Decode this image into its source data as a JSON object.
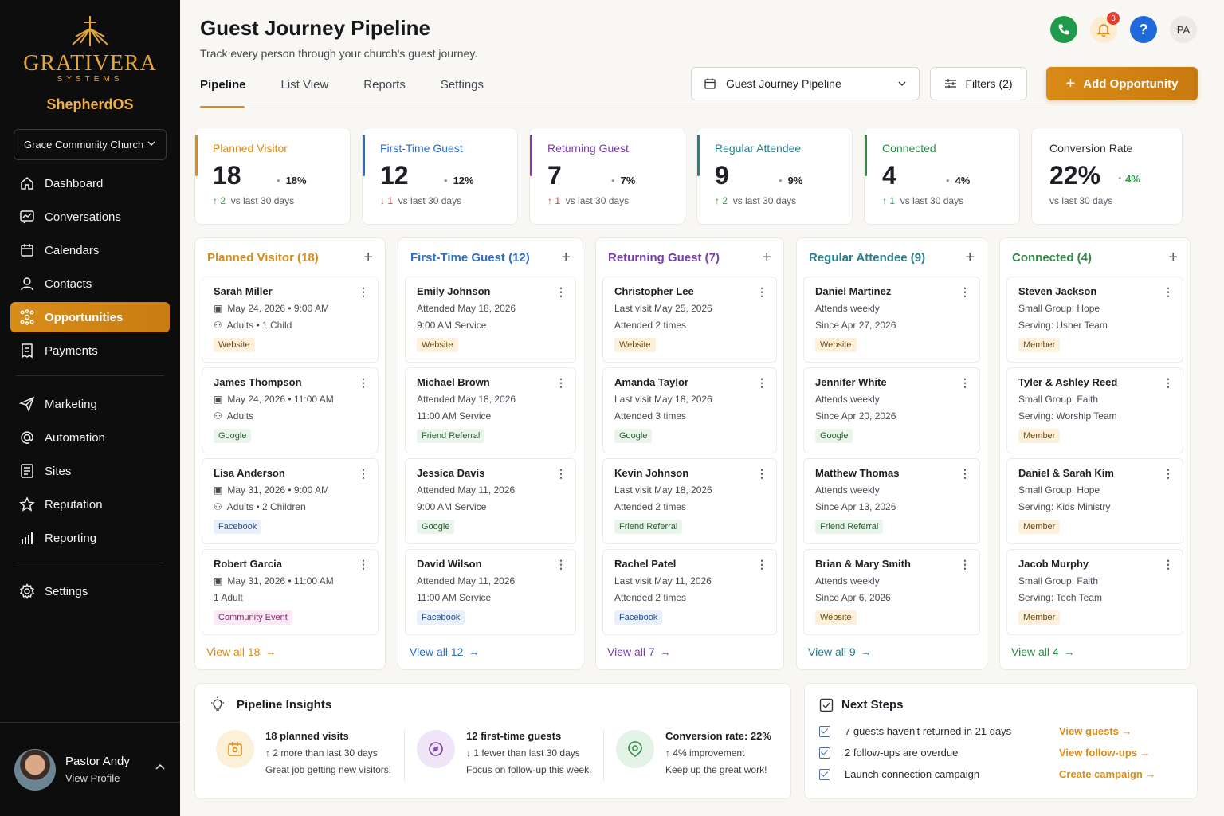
{
  "brand": {
    "name": "GRATIVERA",
    "sub": "SYSTEMS",
    "app": "ShepherdOS"
  },
  "church_selector": "Grace Community Church",
  "nav": [
    {
      "label": "Dashboard",
      "icon": "home-icon"
    },
    {
      "label": "Conversations",
      "icon": "chat-icon"
    },
    {
      "label": "Calendars",
      "icon": "calendar-icon"
    },
    {
      "label": "Contacts",
      "icon": "user-icon"
    },
    {
      "label": "Opportunities",
      "icon": "network-icon",
      "active": true
    },
    {
      "label": "Payments",
      "icon": "receipt-icon"
    },
    {
      "label": "Marketing",
      "icon": "send-icon"
    },
    {
      "label": "Automation",
      "icon": "at-icon"
    },
    {
      "label": "Sites",
      "icon": "sites-icon"
    },
    {
      "label": "Reputation",
      "icon": "star-icon"
    },
    {
      "label": "Reporting",
      "icon": "bars-icon"
    },
    {
      "label": "Settings",
      "icon": "gear-icon"
    }
  ],
  "profile": {
    "name": "Pastor Andy",
    "sub": "View Profile"
  },
  "header": {
    "title": "Guest Journey Pipeline",
    "subtitle": "Track every person through your church's guest journey.",
    "notif_count": "3",
    "initials": "PA"
  },
  "tabs": [
    "Pipeline",
    "List View",
    "Reports",
    "Settings"
  ],
  "pipeline_select": "Guest Journey Pipeline",
  "filters_label": "Filters (2)",
  "add_label": "Add Opportunity",
  "colors": {
    "accent": "#d88d1a",
    "planned": "#d88d1a",
    "first": "#2f6fbf",
    "returning": "#7a3fa6",
    "regular": "#2a7d8c",
    "connected": "#2f8a44"
  },
  "stats": [
    {
      "label": "Planned Visitor",
      "num": "18",
      "pct": "18%",
      "dir": "up",
      "change": "2",
      "foot": "vs last 30 days"
    },
    {
      "label": "First-Time Guest",
      "num": "12",
      "pct": "12%",
      "dir": "down",
      "change": "1",
      "foot": "vs last 30 days"
    },
    {
      "label": "Returning Guest",
      "num": "7",
      "pct": "7%",
      "dir": "up",
      "change": "1",
      "foot": "vs last 30 days"
    },
    {
      "label": "Regular Attendee",
      "num": "9",
      "pct": "9%",
      "dir": "up",
      "change": "2",
      "foot": "vs last 30 days"
    },
    {
      "label": "Connected",
      "num": "4",
      "pct": "4%",
      "dir": "up",
      "change": "1",
      "foot": "vs last 30 days"
    }
  ],
  "conversion": {
    "label": "Conversion Rate",
    "num": "22%",
    "change": "4%",
    "foot": "vs last 30 days"
  },
  "columns": [
    {
      "title": "Planned Visitor (18)",
      "view_all": "View all 18",
      "cards": [
        {
          "name": "Sarah Miller",
          "l1": "May 24, 2026 • 9:00 AM",
          "l2": "Adults • 1 Child",
          "tag": "Website"
        },
        {
          "name": "James Thompson",
          "l1": "May 24, 2026 • 11:00 AM",
          "l2": "Adults",
          "tag": "Google"
        },
        {
          "name": "Lisa Anderson",
          "l1": "May 31, 2026 • 9:00 AM",
          "l2": "Adults • 2 Children",
          "tag": "Facebook"
        },
        {
          "name": "Robert Garcia",
          "l1": "May 31, 2026 • 11:00 AM",
          "l2": "1 Adult",
          "tag": "Community Event"
        }
      ]
    },
    {
      "title": "First-Time Guest (12)",
      "view_all": "View all 12",
      "cards": [
        {
          "name": "Emily Johnson",
          "l1": "Attended May 18, 2026",
          "l2": "9:00 AM Service",
          "tag": "Website"
        },
        {
          "name": "Michael Brown",
          "l1": "Attended May 18, 2026",
          "l2": "11:00 AM Service",
          "tag": "Friend Referral"
        },
        {
          "name": "Jessica Davis",
          "l1": "Attended May 11, 2026",
          "l2": "9:00 AM Service",
          "tag": "Google"
        },
        {
          "name": "David Wilson",
          "l1": "Attended May 11, 2026",
          "l2": "11:00 AM Service",
          "tag": "Facebook"
        }
      ]
    },
    {
      "title": "Returning Guest (7)",
      "view_all": "View all 7",
      "cards": [
        {
          "name": "Christopher Lee",
          "l1": "Last visit May 25, 2026",
          "l2": "Attended 2 times",
          "tag": "Website"
        },
        {
          "name": "Amanda Taylor",
          "l1": "Last visit May 18, 2026",
          "l2": "Attended 3 times",
          "tag": "Google"
        },
        {
          "name": "Kevin Johnson",
          "l1": "Last visit May 18, 2026",
          "l2": "Attended 2 times",
          "tag": "Friend Referral"
        },
        {
          "name": "Rachel Patel",
          "l1": "Last visit May 11, 2026",
          "l2": "Attended 2 times",
          "tag": "Facebook"
        }
      ]
    },
    {
      "title": "Regular Attendee (9)",
      "view_all": "View all 9",
      "cards": [
        {
          "name": "Daniel Martinez",
          "l1": "Attends weekly",
          "l2": "Since Apr 27, 2026",
          "tag": "Website"
        },
        {
          "name": "Jennifer White",
          "l1": "Attends weekly",
          "l2": "Since Apr 20, 2026",
          "tag": "Google"
        },
        {
          "name": "Matthew Thomas",
          "l1": "Attends weekly",
          "l2": "Since Apr 13, 2026",
          "tag": "Friend Referral"
        },
        {
          "name": "Brian & Mary Smith",
          "l1": "Attends weekly",
          "l2": "Since Apr 6, 2026",
          "tag": "Website"
        }
      ]
    },
    {
      "title": "Connected (4)",
      "view_all": "View all 4",
      "cards": [
        {
          "name": "Steven Jackson",
          "l1": "Small Group: Hope",
          "l2": "Serving: Usher Team",
          "tag": "Member"
        },
        {
          "name": "Tyler & Ashley Reed",
          "l1": "Small Group: Faith",
          "l2": "Serving: Worship Team",
          "tag": "Member"
        },
        {
          "name": "Daniel & Sarah Kim",
          "l1": "Small Group: Hope",
          "l2": "Serving: Kids Ministry",
          "tag": "Member"
        },
        {
          "name": "Jacob Murphy",
          "l1": "Small Group: Faith",
          "l2": "Serving: Tech Team",
          "tag": "Member"
        }
      ]
    }
  ],
  "insights": {
    "title": "Pipeline Insights",
    "items": [
      {
        "title": "18 planned visits",
        "l1": "↑ 2 more than last 30 days",
        "l2": "Great job getting new visitors!"
      },
      {
        "title": "12 first-time guests",
        "l1": "↓ 1 fewer than last 30 days",
        "l2": "Focus on follow-up this week."
      },
      {
        "title": "Conversion rate: 22%",
        "l1": "↑ 4% improvement",
        "l2": "Keep up the great work!"
      }
    ]
  },
  "next_steps": {
    "title": "Next Steps",
    "items": [
      {
        "text": "7 guests haven't returned in 21 days",
        "link": "View guests"
      },
      {
        "text": "2 follow-ups are overdue",
        "link": "View follow-ups"
      },
      {
        "text": "Launch connection campaign",
        "link": "Create campaign"
      }
    ]
  }
}
